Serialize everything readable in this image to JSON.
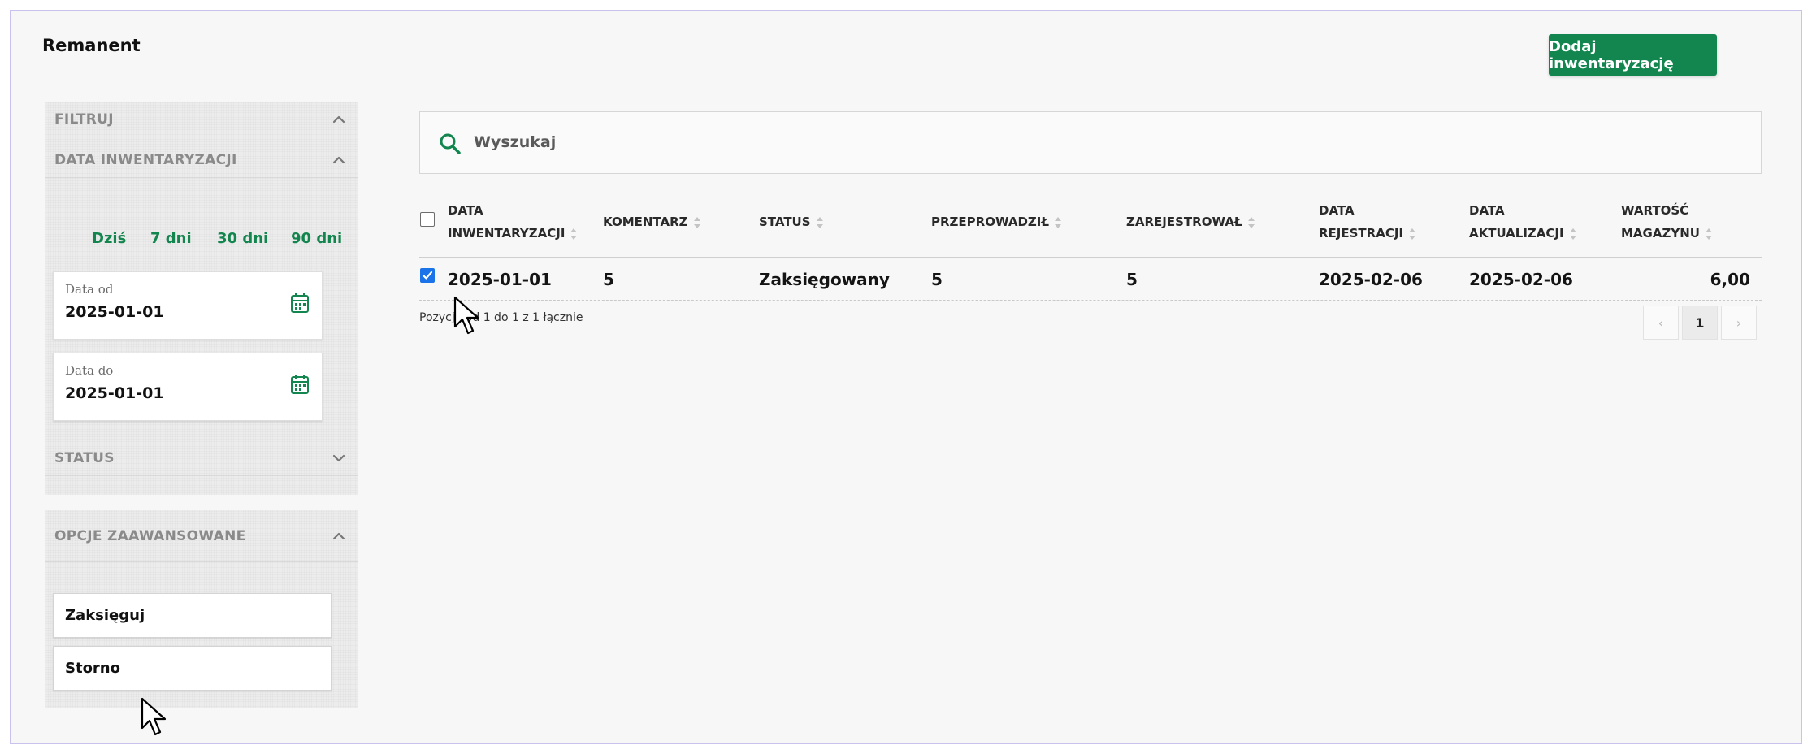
{
  "page": {
    "title": "Remanent",
    "add_button": "Dodaj inwentaryzację"
  },
  "colors": {
    "accent": "#13854e",
    "checkbox": "#1a73e8",
    "frame": "#c9c2ec"
  },
  "sidebar": {
    "filter": {
      "title": "FILTRUJ",
      "date_section": {
        "title": "DATA INWENTARYZACJI",
        "quick_ranges": [
          "Dziś",
          "7 dni",
          "30 dni",
          "90 dni"
        ],
        "date_from": {
          "label": "Data od",
          "value": "2025-01-01"
        },
        "date_to": {
          "label": "Data do",
          "value": "2025-01-01"
        }
      },
      "status_section": {
        "title": "STATUS"
      }
    },
    "advanced": {
      "title": "OPCJE ZAAWANSOWANE",
      "buttons": [
        "Zaksięguj",
        "Storno"
      ]
    }
  },
  "search": {
    "placeholder": "Wyszukaj"
  },
  "table": {
    "columns": [
      {
        "line1": "DATA",
        "line2": "INWENTARYZACJI"
      },
      {
        "line1": "",
        "line2": "KOMENTARZ"
      },
      {
        "line1": "",
        "line2": "STATUS"
      },
      {
        "line1": "",
        "line2": "PRZEPROWADZIŁ"
      },
      {
        "line1": "",
        "line2": "ZAREJESTROWAŁ"
      },
      {
        "line1": "DATA",
        "line2": "REJESTRACJI"
      },
      {
        "line1": "DATA",
        "line2": "AKTUALIZACJI"
      },
      {
        "line1": "WARTOŚĆ",
        "line2": "MAGAZYNU"
      }
    ],
    "rows": [
      {
        "checked": true,
        "cells": [
          "2025-01-01",
          "5",
          "Zaksięgowany",
          "5",
          "5",
          "2025-02-06",
          "2025-02-06",
          "6,00"
        ]
      }
    ],
    "info": "Pozycje od 1 do 1 z 1 łącznie",
    "pagination": {
      "prev": "‹",
      "current": "1",
      "next": "›"
    }
  }
}
